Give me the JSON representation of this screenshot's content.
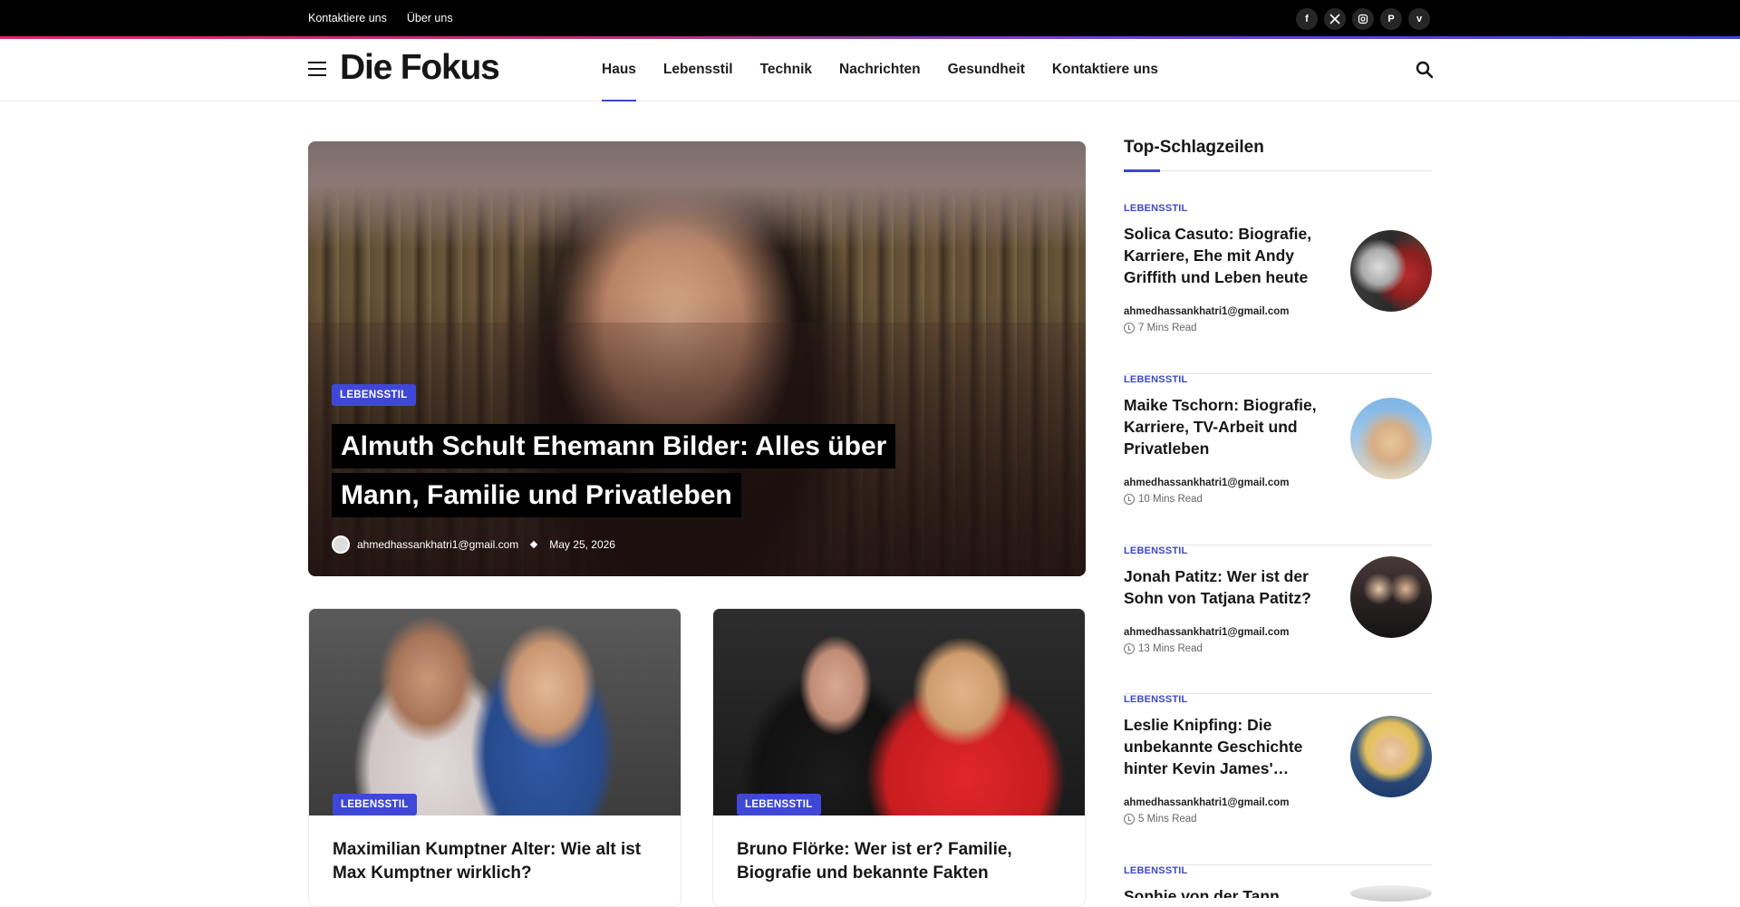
{
  "topbar": {
    "links": [
      "Kontaktiere uns",
      "Über uns"
    ],
    "social": [
      "facebook-icon",
      "x-icon",
      "instagram-icon",
      "pinterest-icon",
      "vimeo-icon"
    ]
  },
  "header": {
    "logo": "Die Fokus",
    "nav": [
      "Haus",
      "Lebensstil",
      "Technik",
      "Nachrichten",
      "Gesundheit",
      "Kontaktiere uns"
    ],
    "active_nav": "Haus"
  },
  "featured": {
    "category": "LEBENSSTIL",
    "title": "Almuth Schult Ehemann Bilder: Alles über Mann, Familie und Privatleben",
    "author": "ahmedhassankhatri1@gmail.com",
    "date": "May 25, 2026"
  },
  "cards": [
    {
      "category": "LEBENSSTIL",
      "title": "Maximilian Kumptner Alter: Wie alt ist Max Kumptner wirklich?"
    },
    {
      "category": "LEBENSSTIL",
      "title": "Bruno Flörke: Wer ist er? Familie, Biografie und bekannte Fakten"
    }
  ],
  "sidebar": {
    "title": "Top-Schlagzeilen",
    "items": [
      {
        "category": "LEBENSSTIL",
        "title": "Solica Casuto: Biografie, Karriere, Ehe mit Andy Griffith und Leben heute",
        "author": "ahmedhassankhatri1@gmail.com",
        "read": "7 Mins Read"
      },
      {
        "category": "LEBENSSTIL",
        "title": "Maike Tschorn: Biografie, Karriere, TV-Arbeit und Privatleben",
        "author": "ahmedhassankhatri1@gmail.com",
        "read": "10 Mins Read"
      },
      {
        "category": "LEBENSSTIL",
        "title": "Jonah Patitz: Wer ist der Sohn von Tatjana Patitz?",
        "author": "ahmedhassankhatri1@gmail.com",
        "read": "13 Mins Read"
      },
      {
        "category": "LEBENSSTIL",
        "title": "Leslie Knipfing: Die unbekannte Geschichte hinter Kevin James'…",
        "author": "ahmedhassankhatri1@gmail.com",
        "read": "5 Mins Read"
      },
      {
        "category": "LEBENSSTIL",
        "title": "Sophie von der Tann"
      }
    ]
  },
  "colors": {
    "accent": "#3d48c9",
    "badge": "#3f48d6",
    "topbar": "#000000"
  }
}
